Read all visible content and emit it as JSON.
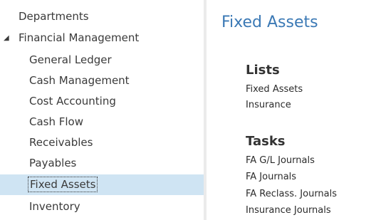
{
  "sidebar": {
    "root_label": "Departments",
    "expanded_item": {
      "label": "Financial Management",
      "caret_icon": "expanded-triangle-icon"
    },
    "children": [
      {
        "label": "General Ledger",
        "selected": false
      },
      {
        "label": "Cash Management",
        "selected": false
      },
      {
        "label": "Cost Accounting",
        "selected": false
      },
      {
        "label": "Cash Flow",
        "selected": false
      },
      {
        "label": "Receivables",
        "selected": false
      },
      {
        "label": "Payables",
        "selected": false
      },
      {
        "label": "Fixed Assets",
        "selected": true
      },
      {
        "label": "Inventory",
        "selected": false
      }
    ]
  },
  "main": {
    "title": "Fixed Assets",
    "lists": {
      "heading": "Lists",
      "items": [
        "Fixed Assets",
        "Insurance"
      ]
    },
    "tasks": {
      "heading": "Tasks",
      "items": [
        "FA G/L Journals",
        "FA Journals",
        "FA Reclass. Journals",
        "Insurance Journals"
      ]
    }
  },
  "colors": {
    "title_blue": "#3b79b5",
    "selection_background": "#cfe4f3",
    "divider": "#ebebeb",
    "text": "#3a3a3a"
  }
}
